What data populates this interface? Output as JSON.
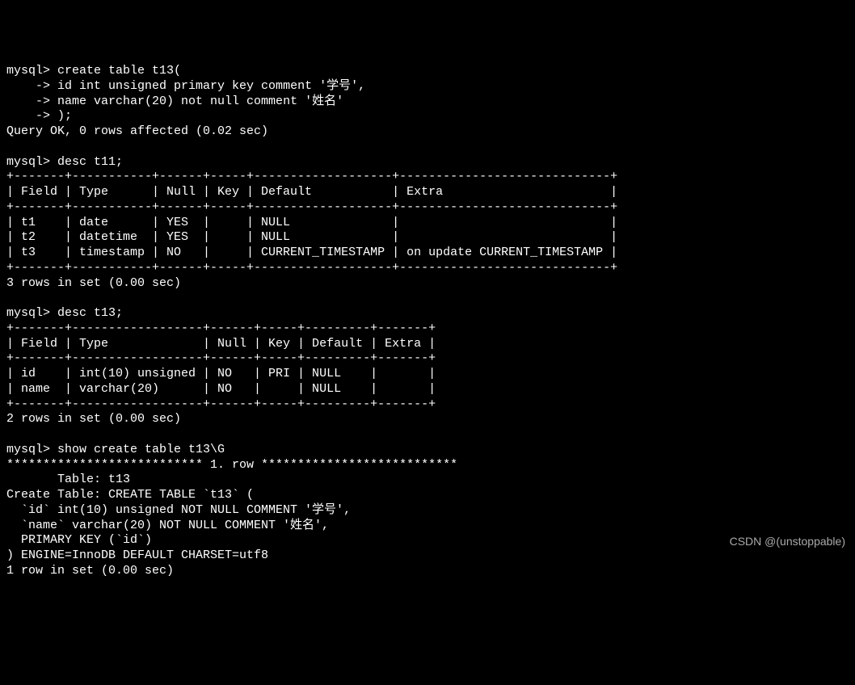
{
  "prompts": {
    "mysql": "mysql>",
    "cont": "    ->"
  },
  "cmd_create": {
    "line1": " create table t13(",
    "line2": " id int unsigned primary key comment '学号',",
    "line3": " name varchar(20) not null comment '姓名'",
    "line4": " );"
  },
  "result_create": "Query OK, 0 rows affected (0.02 sec)",
  "blank": "",
  "cmd_desc_t11": " desc t11;",
  "table_t11": {
    "border": "+-------+-----------+------+-----+-------------------+-----------------------------+",
    "header": "| Field | Type      | Null | Key | Default           | Extra                       |",
    "row1": "| t1    | date      | YES  |     | NULL              |                             |",
    "row2": "| t2    | datetime  | YES  |     | NULL              |                             |",
    "row3": "| t3    | timestamp | NO   |     | CURRENT_TIMESTAMP | on update CURRENT_TIMESTAMP |"
  },
  "result_desc_t11": "3 rows in set (0.00 sec)",
  "cmd_desc_t13": " desc t13;",
  "table_t13": {
    "border": "+-------+------------------+------+-----+---------+-------+",
    "header": "| Field | Type             | Null | Key | Default | Extra |",
    "row1": "| id    | int(10) unsigned | NO   | PRI | NULL    |       |",
    "row2": "| name  | varchar(20)      | NO   |     | NULL    |       |"
  },
  "result_desc_t13": "2 rows in set (0.00 sec)",
  "cmd_show_create": " show create table t13\\G",
  "show_create": {
    "separator": "*************************** 1. row ***************************",
    "table_line": "       Table: t13",
    "create_line1": "Create Table: CREATE TABLE `t13` (",
    "create_line2": "  `id` int(10) unsigned NOT NULL COMMENT '学号',",
    "create_line3": "  `name` varchar(20) NOT NULL COMMENT '姓名',",
    "create_line4": "  PRIMARY KEY (`id`)",
    "create_line5": ") ENGINE=InnoDB DEFAULT CHARSET=utf8"
  },
  "result_show_create": "1 row in set (0.00 sec)",
  "watermark": "CSDN @(unstoppable)"
}
